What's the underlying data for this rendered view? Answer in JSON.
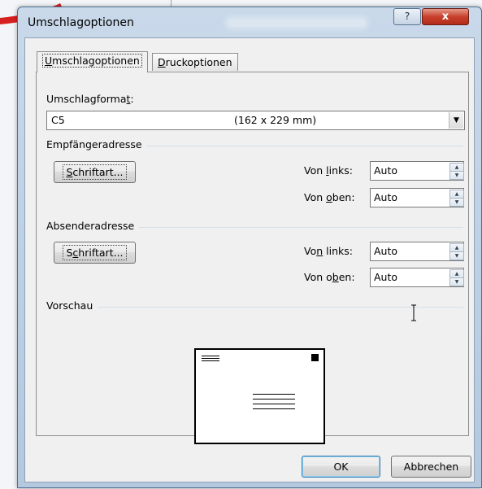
{
  "dialog": {
    "title": "Umschlagoptionen",
    "help_button": "?",
    "close_button": "x",
    "tabs": [
      {
        "label_pre": "",
        "label_key": "U",
        "label_post": "mschlagoptionen",
        "active": true
      },
      {
        "label_pre": "",
        "label_key": "D",
        "label_post": "ruckoptionen",
        "active": false
      }
    ],
    "envelope_size": {
      "label_pre": "Umschlagforma",
      "label_key": "t",
      "label_post": ":",
      "value": "C5",
      "dimensions": "(162 x 229 mm)"
    },
    "recipient": {
      "group_title": "Empfängeradresse",
      "font_button": {
        "pre": "",
        "key": "S",
        "post": "chriftart..."
      },
      "from_left": {
        "pre": "Von ",
        "key": "l",
        "post": "inks:",
        "value": "Auto"
      },
      "from_top": {
        "pre": "Von ",
        "key": "o",
        "post": "ben:",
        "value": "Auto"
      }
    },
    "sender": {
      "group_title": "Absenderadresse",
      "font_button": {
        "pre": "S",
        "key": "c",
        "post": "hriftart..."
      },
      "from_left": {
        "pre": "Vo",
        "key": "n",
        "post": " links:",
        "value": "Auto"
      },
      "from_top": {
        "pre": "Von o",
        "key": "b",
        "post": "en:",
        "value": "Auto"
      }
    },
    "preview": {
      "group_title": "Vorschau"
    },
    "ok_button": "OK",
    "cancel_button": "Abbrechen"
  },
  "icons": {
    "spin_up": "up-arrow-icon",
    "spin_down": "down-arrow-icon",
    "dropdown": "chevron-down-icon",
    "text_cursor": "ibeam-cursor-icon",
    "annotation_arrow": "red-arrow-icon"
  },
  "colors": {
    "title_bar": "#b4c8de",
    "close_button": "#c8402c",
    "annotation_arrow": "#d62020",
    "dialog_background": "#f0f0f0"
  }
}
